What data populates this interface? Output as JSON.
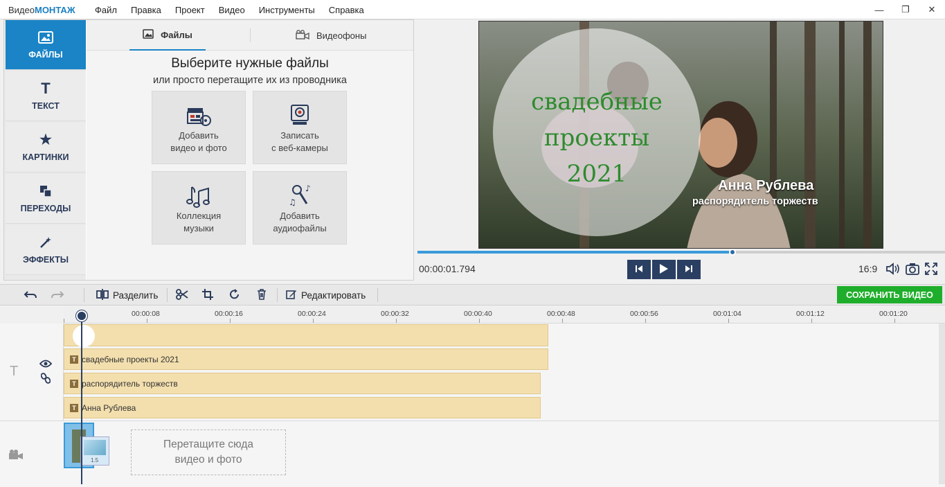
{
  "app": {
    "title_prefix": "Видео",
    "title_brand": "МОНТАЖ"
  },
  "menu": [
    "Файл",
    "Правка",
    "Проект",
    "Видео",
    "Инструменты",
    "Справка"
  ],
  "window": {
    "minimize": "—",
    "restore": "❐",
    "close": "✕"
  },
  "nav": [
    {
      "label": "ФАЙЛЫ",
      "icon": "image-icon"
    },
    {
      "label": "ТЕКСТ",
      "icon": "text-icon"
    },
    {
      "label": "КАРТИНКИ",
      "icon": "star-icon"
    },
    {
      "label": "ПЕРЕХОДЫ",
      "icon": "transitions-icon"
    },
    {
      "label": "ЭФФЕКТЫ",
      "icon": "magic-wand-icon"
    }
  ],
  "tabs": {
    "files": "Файлы",
    "backgrounds": "Видеофоны"
  },
  "content": {
    "heading": "Выберите нужные файлы",
    "subheading": "или просто перетащите их из проводника",
    "tiles": [
      {
        "line1": "Добавить",
        "line2": "видео и фото"
      },
      {
        "line1": "Записать",
        "line2": "с веб-камеры"
      },
      {
        "line1": "Коллекция",
        "line2": "музыки"
      },
      {
        "line1": "Добавить",
        "line2": "аудиофайлы"
      }
    ]
  },
  "preview": {
    "title_line1": "свадебные",
    "title_line2": "проекты",
    "title_line3": "2021",
    "name": "Анна Рублева",
    "role": "распорядитель торжеств",
    "progress": 0.597,
    "timecode": "00:00:01.794",
    "ratio": "16:9"
  },
  "toolbar": {
    "split": "Разделить",
    "edit": "Редактировать",
    "save": "СОХРАНИТЬ ВИДЕО"
  },
  "ruler": [
    "00:00:08",
    "00:00:16",
    "00:00:24",
    "00:00:32",
    "00:00:40",
    "00:00:48",
    "00:00:56",
    "00:01:04",
    "00:01:12",
    "00:01:20"
  ],
  "clips": {
    "c1": "свадебные  проекты  2021",
    "c2": "распорядитель торжеств",
    "c3": "Анна Рублева"
  },
  "videotrack": {
    "thumb_label": "1.5",
    "drop_line1": "Перетащите сюда",
    "drop_line2": "видео и фото"
  },
  "colors": {
    "accent": "#1a84c6",
    "save": "#1fae2b",
    "clip": "#f3dfae",
    "title_text": "#2e8b2e"
  }
}
